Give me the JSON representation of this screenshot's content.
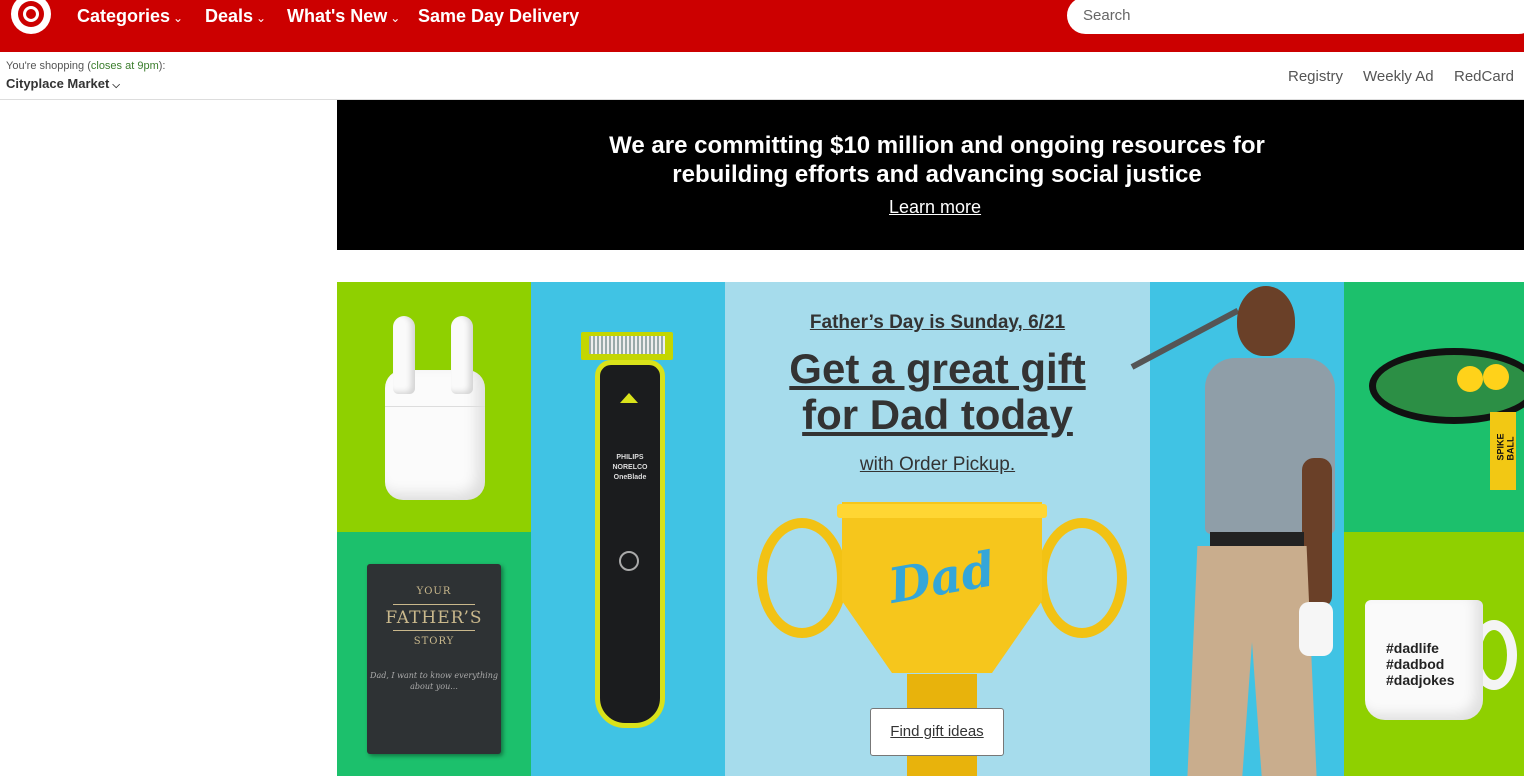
{
  "header": {
    "nav": [
      {
        "label": "Categories",
        "has_menu": true
      },
      {
        "label": "Deals",
        "has_menu": true
      },
      {
        "label": "What's New",
        "has_menu": true
      },
      {
        "label": "Same Day Delivery",
        "has_menu": false
      }
    ],
    "search_placeholder": "Search"
  },
  "store": {
    "prefix": "You're shopping (",
    "closes": "closes at 9pm",
    "suffix": "):",
    "name": "Cityplace Market",
    "links": [
      "Registry",
      "Weekly Ad",
      "RedCard"
    ]
  },
  "banner": {
    "line1": "We are committing $10 million and ongoing resources for",
    "line2": "rebuilding efforts and advancing social justice",
    "link": "Learn more"
  },
  "hero": {
    "date_line": "Father’s Day is Sunday, 6/21",
    "title_line1": "Get a great gift",
    "title_line2": "for Dad today",
    "pickup": "with Order Pickup.",
    "button": "Find gift ideas",
    "trophy_text": "Dad",
    "book": {
      "l1": "YOUR",
      "l2": "FATHER’S",
      "l3": "STORY",
      "sub": "Dad, I want to know everything about you..."
    },
    "shaver_text": "PHILIPS NORELCO OneBlade",
    "spikeball_text": "SPIKE BALL",
    "mug_lines": [
      "#dadlife",
      "#dadbod",
      "#dadjokes"
    ]
  },
  "colors": {
    "brand_red": "#cc0000",
    "banner_bg": "#000000"
  }
}
